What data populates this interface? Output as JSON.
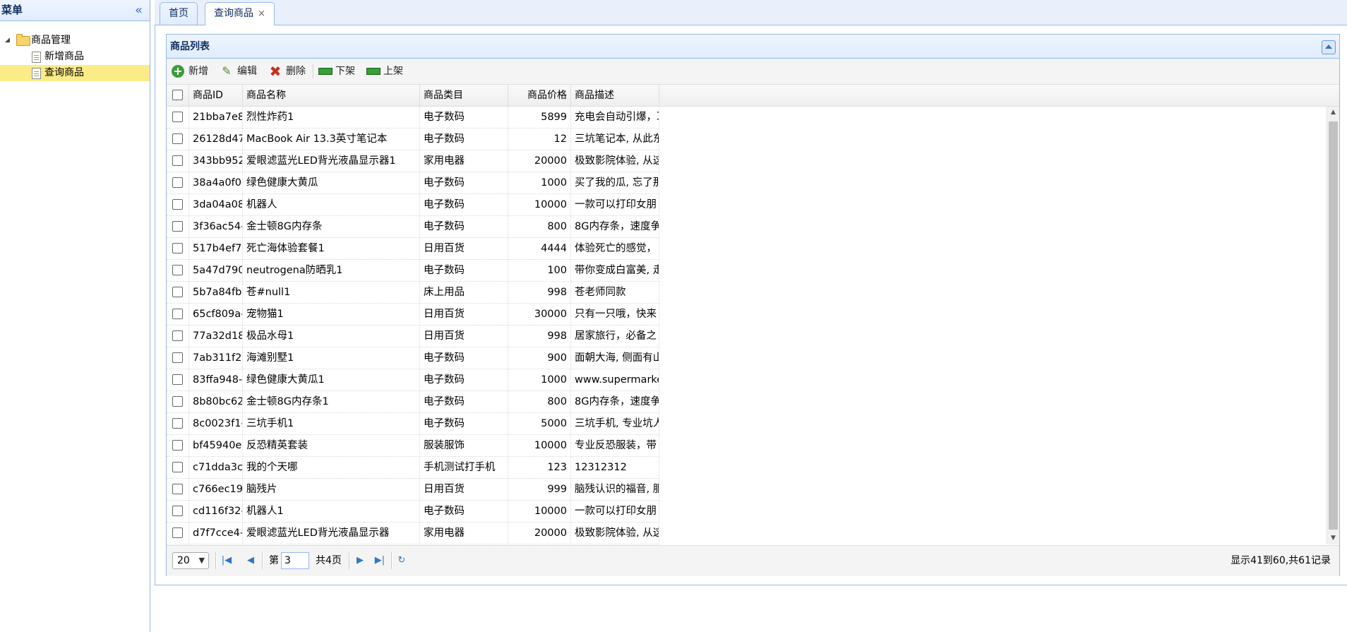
{
  "menu": {
    "title": "菜单",
    "collapse_icon": "double-chevron-left-icon",
    "tree": {
      "root_label": "商品管理",
      "items": [
        {
          "label": "新增商品",
          "selected": false
        },
        {
          "label": "查询商品",
          "selected": true
        }
      ]
    }
  },
  "tabs": [
    {
      "label": "首页",
      "active": false
    },
    {
      "label": "查询商品",
      "active": true,
      "closable": true
    }
  ],
  "panel": {
    "title": "商品列表",
    "toolbar": {
      "add": "新增",
      "edit": "编辑",
      "delete": "删除",
      "off_shelf": "下架",
      "on_shelf": "上架"
    },
    "columns": [
      "商品ID",
      "商品名称",
      "商品类目",
      "商品价格",
      "商品描述"
    ],
    "rows": [
      {
        "id": "21bba7e8",
        "name": "烈性炸药1",
        "category": "电子数码",
        "price": "5899",
        "desc": "充电会自动引爆，耳"
      },
      {
        "id": "26128d47",
        "name": "MacBook Air 13.3英寸笔记本",
        "category": "电子数码",
        "price": "12",
        "desc": "三坑笔记本, 从此东"
      },
      {
        "id": "343bb952",
        "name": "爱眼滤蓝光LED背光液晶显示器1",
        "category": "家用电器",
        "price": "20000",
        "desc": "极致影院体验, 从这"
      },
      {
        "id": "38a4a0f0-",
        "name": "绿色健康大黄瓜",
        "category": "电子数码",
        "price": "1000",
        "desc": "买了我的瓜, 忘了那"
      },
      {
        "id": "3da04a08",
        "name": "机器人",
        "category": "电子数码",
        "price": "10000",
        "desc": "一款可以打印女朋"
      },
      {
        "id": "3f36ac54-",
        "name": "金士顿8G内存条",
        "category": "电子数码",
        "price": "800",
        "desc": "8G内存条，速度争"
      },
      {
        "id": "517b4ef7",
        "name": "死亡海体验套餐1",
        "category": "日用百货",
        "price": "4444",
        "desc": "体验死亡的感觉，"
      },
      {
        "id": "5a47d790",
        "name": "neutrogena防晒乳1",
        "category": "电子数码",
        "price": "100",
        "desc": "带你变成白富美, 走"
      },
      {
        "id": "5b7a84fb",
        "name": "苍#null1",
        "category": "床上用品",
        "price": "998",
        "desc": "苍老师同款"
      },
      {
        "id": "65cf809a-",
        "name": "宠物猫1",
        "category": "日用百货",
        "price": "30000",
        "desc": "只有一只哦，快来"
      },
      {
        "id": "77a32d18",
        "name": "极品水母1",
        "category": "日用百货",
        "price": "998",
        "desc": "居家旅行，必备之"
      },
      {
        "id": "7ab311f2",
        "name": "海滩别墅1",
        "category": "电子数码",
        "price": "900",
        "desc": "面朝大海, 侧面有山"
      },
      {
        "id": "83ffa948-",
        "name": "绿色健康大黄瓜1",
        "category": "电子数码",
        "price": "1000",
        "desc": "www.supermarke"
      },
      {
        "id": "8b80bc62",
        "name": "金士顿8G内存条1",
        "category": "电子数码",
        "price": "800",
        "desc": "8G内存条，速度争"
      },
      {
        "id": "8c0023f1-",
        "name": "三坑手机1",
        "category": "电子数码",
        "price": "5000",
        "desc": "三坑手机, 专业坑人"
      },
      {
        "id": "bf45940e",
        "name": "反恐精英套装",
        "category": "服装服饰",
        "price": "10000",
        "desc": "专业反恐服装，带"
      },
      {
        "id": "c71dda3c",
        "name": "我的个天哪",
        "category": "手机测试打手机",
        "price": "123",
        "desc": "12312312"
      },
      {
        "id": "c766ec19",
        "name": "脑残片",
        "category": "日用百货",
        "price": "999",
        "desc": "脑残认识的福音, 服"
      },
      {
        "id": "cd116f32-",
        "name": "机器人1",
        "category": "电子数码",
        "price": "10000",
        "desc": "一款可以打印女朋"
      },
      {
        "id": "d7f7cce4-",
        "name": "爱眼滤蓝光LED背光液晶显示器",
        "category": "家用电器",
        "price": "20000",
        "desc": "极致影院体验, 从这"
      }
    ],
    "pager": {
      "page_size": "20",
      "page_prefix": "第",
      "current_page": "3",
      "page_suffix": "共4页",
      "info": "显示41到60,共61记录"
    }
  }
}
